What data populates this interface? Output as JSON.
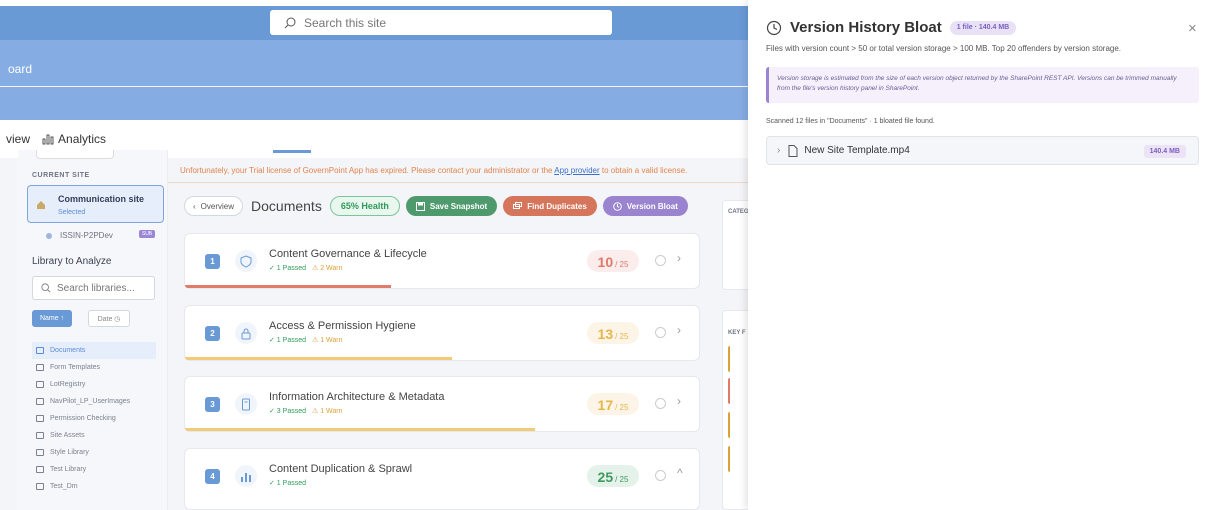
{
  "header": {
    "search_placeholder": "Search this site",
    "board_text": "oard",
    "nav_view": "view",
    "nav_analytics": "Analytics"
  },
  "sidebar": {
    "current_site_label": "CURRENT SITE",
    "site_name": "Communication site",
    "site_status": "Selected",
    "sub_site": "ISSIN-P2PDev",
    "sub_site_tag": "SUB",
    "library_title": "Library to Analyze",
    "library_search_placeholder": "Search libraries...",
    "sort_name": "Name ↑",
    "sort_date": "Date ◷",
    "libraries": [
      {
        "label": "Documents",
        "active": true
      },
      {
        "label": "Form Templates",
        "active": false
      },
      {
        "label": "LotRegistry",
        "active": false
      },
      {
        "label": "NavPilot_LP_UserImages",
        "active": false
      },
      {
        "label": "Permission Checking",
        "active": false
      },
      {
        "label": "Site Assets",
        "active": false
      },
      {
        "label": "Style Library",
        "active": false
      },
      {
        "label": "Test Library",
        "active": false
      },
      {
        "label": "Test_Dm",
        "active": false
      }
    ]
  },
  "main": {
    "trial_text_before": "Unfortunately, your Trial license of GovernPoint App has expired. Please contact your administrator or the ",
    "trial_link": "App provider",
    "trial_text_after": " to obtain a valid license.",
    "overview_btn": "Overview",
    "doc_title": "Documents",
    "health": "65% Health",
    "save_snapshot": "Save Snapshot",
    "find_duplicates": "Find Duplicates",
    "version_bloat": "Version Bloat",
    "cards": [
      {
        "num": "1",
        "title": "Content Governance & Lifecycle",
        "passed": "✓ 1 Passed",
        "warn": "⚠ 2 Warn",
        "score": "10",
        "total": "/ 25",
        "score_color": "#e07a6a",
        "bar_color": "#e07a6a",
        "bar_fraction": 0.4,
        "chevron": "›"
      },
      {
        "num": "2",
        "title": "Access & Permission Hygiene",
        "passed": "✓ 1 Passed",
        "warn": "⚠ 1 Warn",
        "score": "13",
        "total": "/ 25",
        "score_color": "#e7b54a",
        "bar_color": "#f0cc76",
        "bar_fraction": 0.52,
        "chevron": "›"
      },
      {
        "num": "3",
        "title": "Information Architecture & Metadata",
        "passed": "✓ 3 Passed",
        "warn": "⚠ 1 Warn",
        "score": "17",
        "total": "/ 25",
        "score_color": "#e7b54a",
        "bar_color": "#f0cc76",
        "bar_fraction": 0.68,
        "chevron": "›"
      },
      {
        "num": "4",
        "title": "Content Duplication & Sprawl",
        "passed": "✓ 1 Passed",
        "warn": "",
        "score": "25",
        "total": "/ 25",
        "score_color": "#3f9a5f",
        "bar_color": "#3f9a5f",
        "bar_fraction": 0,
        "chevron": "^"
      }
    ],
    "right_labels": {
      "categ": "CATEG",
      "keyf": "KEY F"
    }
  },
  "panel": {
    "title": "Version History Bloat",
    "badge": "1 file · 140.4 MB",
    "description": "Files with version count > 50 or total version storage > 100 MB. Top 20 offenders by version storage.",
    "note": "Version storage is estimated from the size of each version object returned by the SharePoint REST API. Versions can be trimmed manually from the file's version history panel in SharePoint.",
    "scan_summary": "Scanned 12 files in \"Documents\" · 1 bloated file found.",
    "files": [
      {
        "name": "New Site Template.mp4",
        "size": "140.4 MB"
      }
    ],
    "close": "×"
  },
  "colors": {
    "accent": "#6a9ad6",
    "purple": "#9a83cf",
    "green": "#4f9a6c",
    "orange": "#d5765c"
  }
}
